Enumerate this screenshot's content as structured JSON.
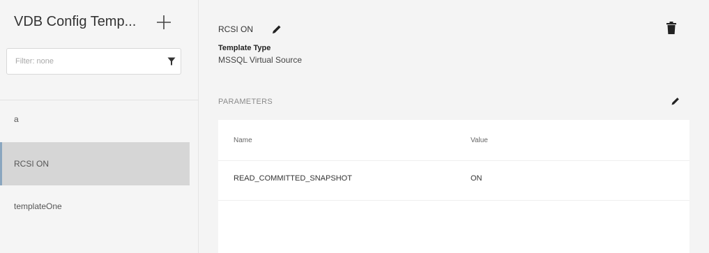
{
  "sidebar": {
    "title": "VDB Config Temp...",
    "add_icon": "plus-icon",
    "filter": {
      "placeholder": "Filter: none",
      "value": "",
      "icon": "funnel-filter-icon"
    },
    "items": [
      {
        "label": "a",
        "selected": false
      },
      {
        "label": "RCSI ON",
        "selected": true
      },
      {
        "label": "templateOne",
        "selected": false
      }
    ]
  },
  "detail": {
    "title": "RCSI ON",
    "edit_icon": "pencil-icon",
    "delete_icon": "trash-icon",
    "template_type_label": "Template Type",
    "template_type_value": "MSSQL Virtual Source",
    "parameters_heading": "PARAMETERS",
    "parameters_edit_icon": "pencil-icon",
    "table": {
      "columns": [
        "Name",
        "Value"
      ],
      "rows": [
        {
          "name": "READ_COMMITTED_SNAPSHOT",
          "value": "ON"
        }
      ]
    }
  },
  "colors": {
    "selected_bg": "#d6d6d6",
    "selected_border": "#8aa6bf",
    "sidebar_bg": "#f5f5f5",
    "content_bg": "#f4f4f4"
  }
}
